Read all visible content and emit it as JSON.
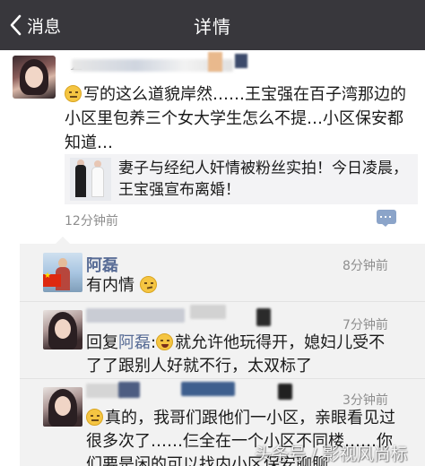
{
  "nav": {
    "back_label": "消息",
    "title": "详情"
  },
  "post": {
    "text_emoji": "smiling-eyes-emoji",
    "text": "写的这么道貌岸然……王宝强在百子湾那边的小区里包养三个女大学生怎么不提…小区保安都知道…",
    "link": {
      "title": "妻子与经纪人奸情被粉丝实拍！今日凌晨，王宝强宣布离婚！"
    },
    "time": "12分钟前"
  },
  "comments": [
    {
      "name": "阿磊",
      "time": "8分钟前",
      "text": "有内情",
      "trailing_emoji": "smirk-emoji"
    },
    {
      "time": "7分钟前",
      "reply_prefix": "回复",
      "reply_to": "阿磊",
      "colon": ":",
      "text": "就允许他玩得开，媳妇儿受不了了跟别人好就不行，太双标了",
      "leading_emoji": "laughing-emoji"
    },
    {
      "time": "3分钟前",
      "text": "真的，我哥们跟他们一小区，亲眼看见过很多次了……仨全在一个小区不同楼……你们要是闲的可以找内小区保安聊聊",
      "leading_emoji": "smiling-eyes-emoji"
    }
  ],
  "watermark": "头条号 / 影视风尚标"
}
